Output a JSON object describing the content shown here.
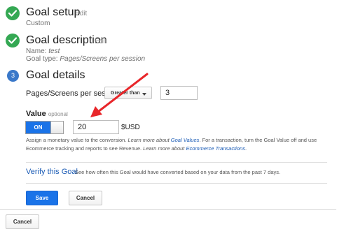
{
  "steps": {
    "goal_setup": {
      "number": "1",
      "title": "Goal setup",
      "edit_label": "Edit",
      "summary": "Custom"
    },
    "goal_description": {
      "number": "2",
      "title": "Goal description",
      "edit_label": "Edit",
      "name_label": "Name: ",
      "name_value": "test",
      "type_label": "Goal type: ",
      "type_value": "Pages/Screens per session"
    },
    "goal_details": {
      "number": "3",
      "title": "Goal details",
      "condition_label": "Pages/Screens per session",
      "operator_value": "Greater than",
      "threshold_value": "3",
      "value_label": "Value",
      "value_optional": "optional",
      "toggle_label": "ON",
      "value_amount": "20",
      "currency": "$USD",
      "assist_text_1": "Assign a monetary value to the conversion. ",
      "assist_link_prefix_1": "Learn more about ",
      "assist_link_1": "Goal Values",
      "assist_text_2": ". For a transaction, turn the Goal Value off and use Ecommerce tracking and reports to see Revenue. ",
      "assist_link_prefix_2": "Learn more about ",
      "assist_link_2": "Ecommerce Transactions",
      "assist_text_3": "."
    }
  },
  "verify": {
    "link_label": "Verify this Goal",
    "description": "See how often this Goal would have converted based on your data from the past 7 days."
  },
  "actions": {
    "save_label": "Save",
    "cancel_label": "Cancel",
    "outer_cancel_label": "Cancel"
  },
  "colors": {
    "check_green": "#34a853",
    "step_blue": "#3a78c9",
    "primary_blue": "#1a73e8",
    "link_blue": "#1a5bb5",
    "annotation_red": "#e8262a"
  },
  "icons": {
    "completed_step": "checkmark-icon",
    "dropdown": "caret-down-icon",
    "annotation": "red-arrow"
  }
}
